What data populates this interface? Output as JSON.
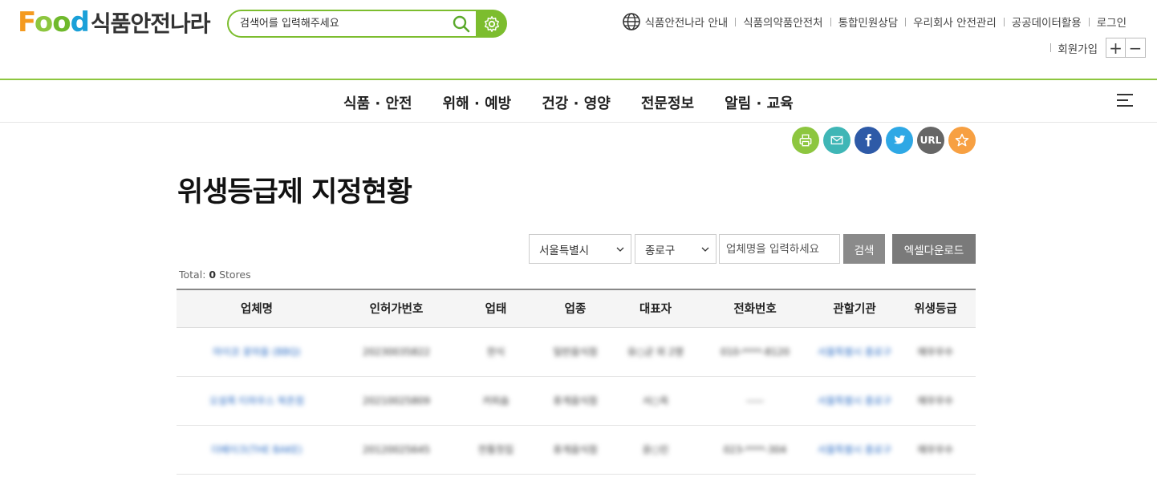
{
  "header": {
    "logo": {
      "word": "Food",
      "text": "식품안전나라"
    },
    "search": {
      "placeholder": "검색어를 입력해주세요"
    },
    "util_links": [
      "식품안전나라 안내",
      "식품의약품안전처",
      "통합민원상담",
      "우리회사 안전관리",
      "공공데이터활용",
      "로그인"
    ],
    "util_links_row2": [
      "회원가입"
    ],
    "zoom_in": "+",
    "zoom_out": "−"
  },
  "gnb": [
    "식품 · 안전",
    "위해 · 예방",
    "건강 · 영양",
    "전문정보",
    "알림 · 교육"
  ],
  "share": {
    "url_label": "URL"
  },
  "page_title": "위생등급제 지정현황",
  "filter": {
    "city": "서울특별시",
    "district": "종로구",
    "name_placeholder": "업체명을 입력하세요",
    "search_label": "검색",
    "excel_label": "엑셀다운로드"
  },
  "total": {
    "prefix": "Total: ",
    "count": "0",
    "suffix": " Stores"
  },
  "table": {
    "columns": [
      "업체명",
      "인허가번호",
      "업태",
      "업종",
      "대표자",
      "전화번호",
      "관할기관",
      "위생등급"
    ],
    "rows": [
      [
        "마이코 꽃마을 (BBQ)",
        "20230035822",
        "한식",
        "일반음식점",
        "유○균 외 2명",
        "010-****-8120",
        "서울특별시 종로구",
        "매우우수"
      ],
      [
        "오설록 티하우스 북촌점",
        "20210025809",
        "커피숍",
        "휴게음식점",
        "서○옥",
        "-----",
        "서울특별시 종로구",
        "매우우수"
      ],
      [
        "더베이크(THE BAKE)",
        "20120025645",
        "전통찻집",
        "휴게음식점",
        "윤○민",
        "023-****-304",
        "서울특별시 종로구",
        "매우우수"
      ]
    ]
  },
  "colors": {
    "brand_green": "#8dc63f",
    "link_blue": "#2b6cc4"
  }
}
